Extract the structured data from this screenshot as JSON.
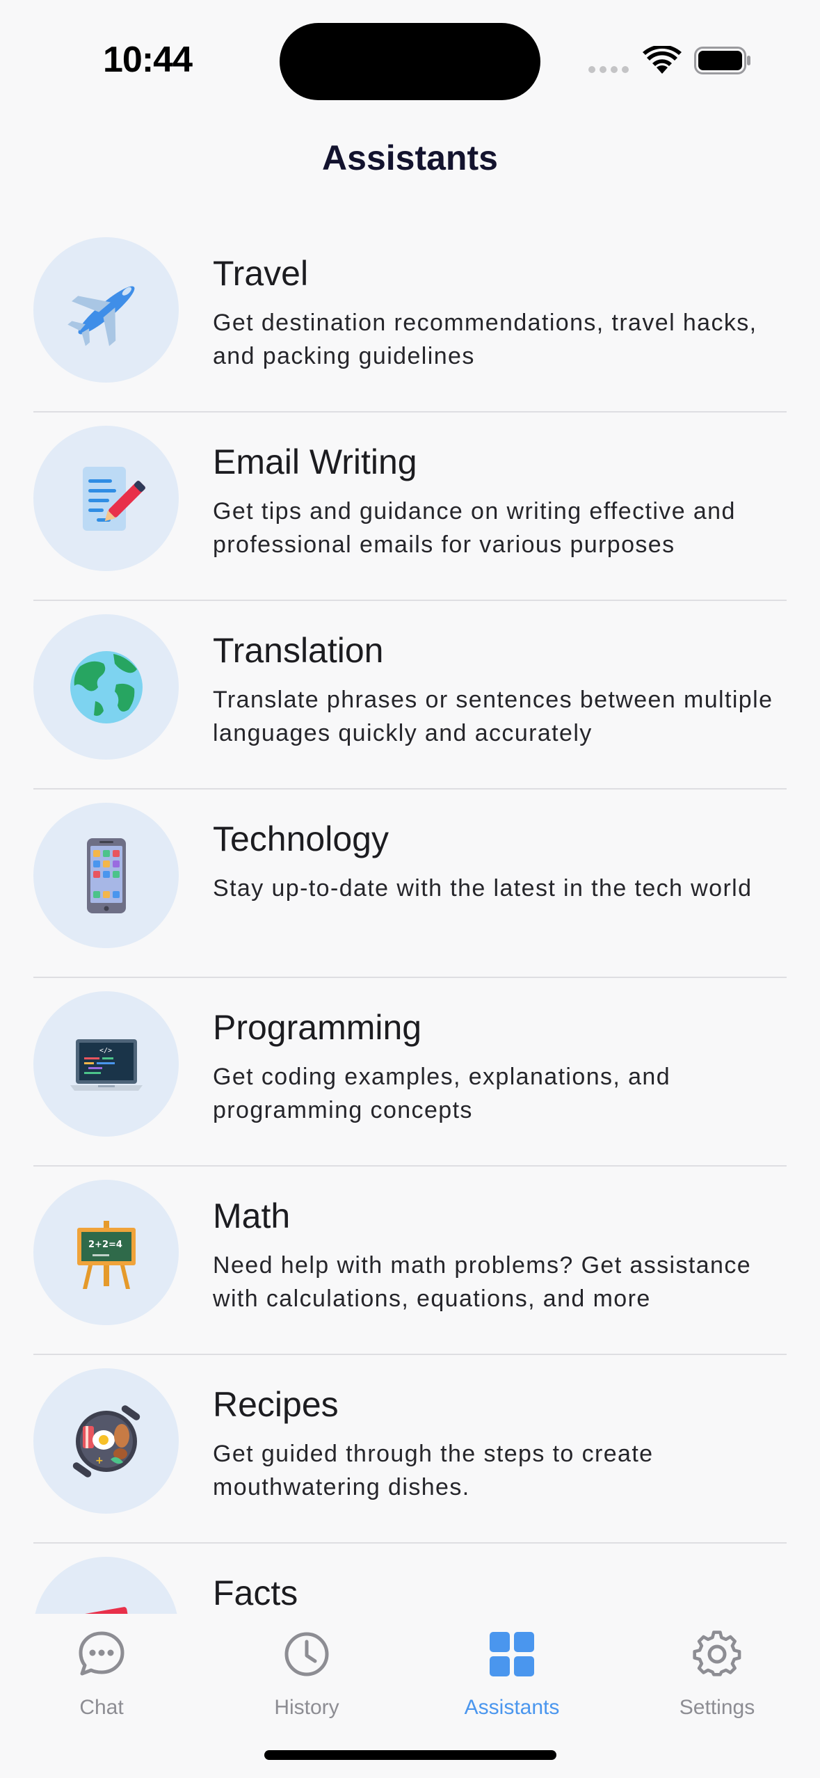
{
  "status_bar": {
    "time": "10:44"
  },
  "header": {
    "title": "Assistants"
  },
  "assistants": [
    {
      "title": "Travel",
      "description": "Get destination recommendations, travel hacks, and packing guidelines",
      "icon": "airplane-icon"
    },
    {
      "title": "Email Writing",
      "description": "Get tips and guidance on writing effective and professional emails for various purposes",
      "icon": "document-pencil-icon"
    },
    {
      "title": "Translation",
      "description": "Translate phrases or sentences between multiple languages quickly and accurately",
      "icon": "globe-icon"
    },
    {
      "title": "Technology",
      "description": "Stay up-to-date with the latest in the tech world",
      "icon": "smartphone-icon"
    },
    {
      "title": "Programming",
      "description": "Get coding examples, explanations, and programming concepts",
      "icon": "laptop-code-icon"
    },
    {
      "title": "Math",
      "description": "Need help with math problems? Get assistance with calculations, equations, and more",
      "icon": "chalkboard-icon"
    },
    {
      "title": "Recipes",
      "description": "Get guided through the steps to create mouthwatering dishes.",
      "icon": "frying-pan-icon"
    },
    {
      "title": "Facts",
      "description": "",
      "icon": "newspaper-icon"
    }
  ],
  "tab_bar": {
    "tabs": [
      {
        "label": "Chat",
        "icon": "chat-bubble-icon",
        "active": false
      },
      {
        "label": "History",
        "icon": "clock-icon",
        "active": false
      },
      {
        "label": "Assistants",
        "icon": "grid-icon",
        "active": true
      },
      {
        "label": "Settings",
        "icon": "gear-icon",
        "active": false
      }
    ]
  },
  "colors": {
    "accent": "#4a96ee",
    "inactive": "#8d8d93",
    "avatar_bg": "#e2ebf7",
    "background": "#f8f8f9"
  }
}
